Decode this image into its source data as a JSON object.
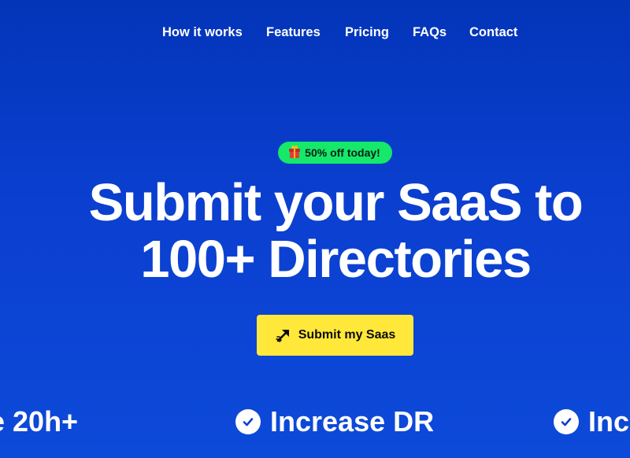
{
  "nav": {
    "items": [
      {
        "label": "How it works"
      },
      {
        "label": "Features"
      },
      {
        "label": "Pricing"
      },
      {
        "label": "FAQs"
      },
      {
        "label": "Contact"
      }
    ]
  },
  "badge": {
    "icon": "gift-icon",
    "text": "50% off today!",
    "color": "#16e86a"
  },
  "hero": {
    "title_line1": "Submit your SaaS to",
    "title_line2": "100+ Directories"
  },
  "cta": {
    "icon": "rocket-arrow-icon",
    "label": "Submit my Saas",
    "color": "#ffe83a"
  },
  "marquee": {
    "items": [
      {
        "text": "e 20h+",
        "icon": "check-icon"
      },
      {
        "text": "Increase DR",
        "icon": "check-icon"
      },
      {
        "text": "Inc",
        "icon": "check-icon"
      }
    ]
  },
  "colors": {
    "background": "#0b3fd0",
    "text": "#ffffff"
  }
}
